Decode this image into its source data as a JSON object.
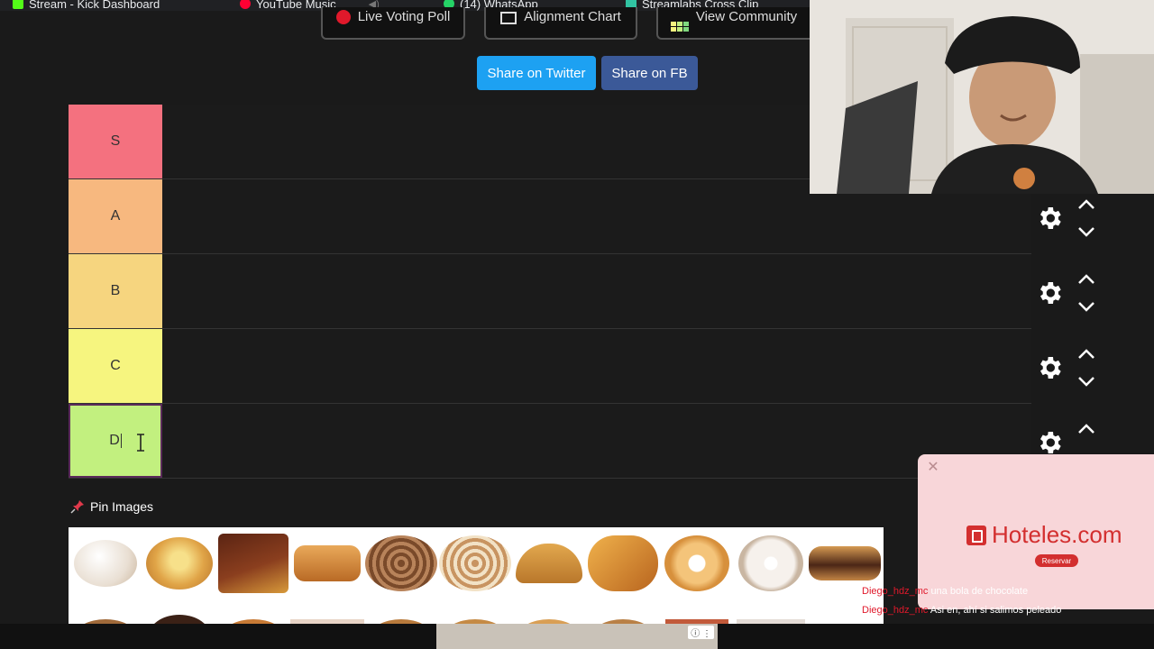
{
  "bookmarks": [
    {
      "label": "Stream - Kick Dashboard",
      "color": "#53fc18"
    },
    {
      "label": "YouTube Music",
      "color": "#ff0033"
    },
    {
      "label": "(14) WhatsApp",
      "color": "#25d366"
    },
    {
      "label": "Streamlabs Cross Clip",
      "color": "#31c3a2"
    }
  ],
  "nav": {
    "live_voting": "Live Voting Poll",
    "alignment_chart": "Alignment Chart",
    "view_community": "View Community"
  },
  "share": {
    "twitter": "Share on Twitter",
    "facebook": "Share on FB"
  },
  "tiers": [
    {
      "label": "S",
      "color": "#f4717f"
    },
    {
      "label": "A",
      "color": "#f7b87f"
    },
    {
      "label": "B",
      "color": "#f6d57f"
    },
    {
      "label": "C",
      "color": "#f6f57f"
    },
    {
      "label": "D",
      "color": "#c2f07f"
    }
  ],
  "pin_images": {
    "label": "Pin Images",
    "icon": "pushpin-icon"
  },
  "ad": {
    "brand": "Hoteles.com",
    "cta": "Reservar"
  },
  "chat": [
    {
      "user": "Diego_hdz_mc",
      "message": "una bola de chocolate"
    },
    {
      "user": "Diego_hdz_mc",
      "message": "Asi en, ahí si salimos peleado"
    }
  ],
  "colors": {
    "twitter": "#1da1f2",
    "facebook": "#3b5998",
    "accent_red": "#d32f2f"
  }
}
